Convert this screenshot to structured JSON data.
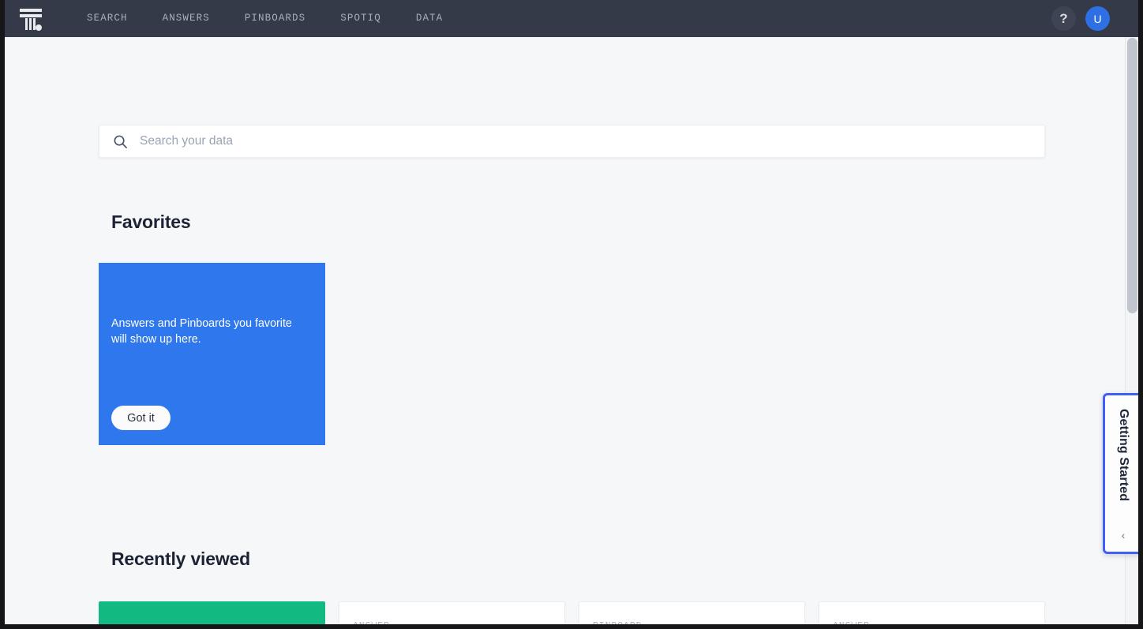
{
  "app": {
    "logo_name": "thoughtspot-logo",
    "nav_bg": "#343a47",
    "accent_blue": "#2f77ec",
    "accent_green": "#12b981",
    "focus_outline": "#3f5efb"
  },
  "topnav": {
    "links": [
      {
        "label": "SEARCH",
        "name": "nav-link-search"
      },
      {
        "label": "ANSWERS",
        "name": "nav-link-answers"
      },
      {
        "label": "PINBOARDS",
        "name": "nav-link-pinboards"
      },
      {
        "label": "SPOTIQ",
        "name": "nav-link-spotiq"
      },
      {
        "label": "DATA",
        "name": "nav-link-data"
      }
    ],
    "help_label": "?",
    "avatar_initial": "U"
  },
  "search": {
    "placeholder": "Search your data",
    "value": "",
    "icon": "search-icon"
  },
  "favorites": {
    "title": "Favorites",
    "card": {
      "message": "Answers and Pinboards you favorite will show up here.",
      "button_label": "Got it"
    }
  },
  "recent": {
    "title": "Recently viewed",
    "cards": [
      {
        "kind": "",
        "color": "green"
      },
      {
        "kind": "ANSWER",
        "color": "white"
      },
      {
        "kind": "PINBOARD",
        "color": "white"
      },
      {
        "kind": "ANSWER",
        "color": "white"
      }
    ]
  },
  "getting_started": {
    "label": "Getting Started",
    "collapse_icon": "chevron-left-icon",
    "collapse_glyph": "‹"
  }
}
